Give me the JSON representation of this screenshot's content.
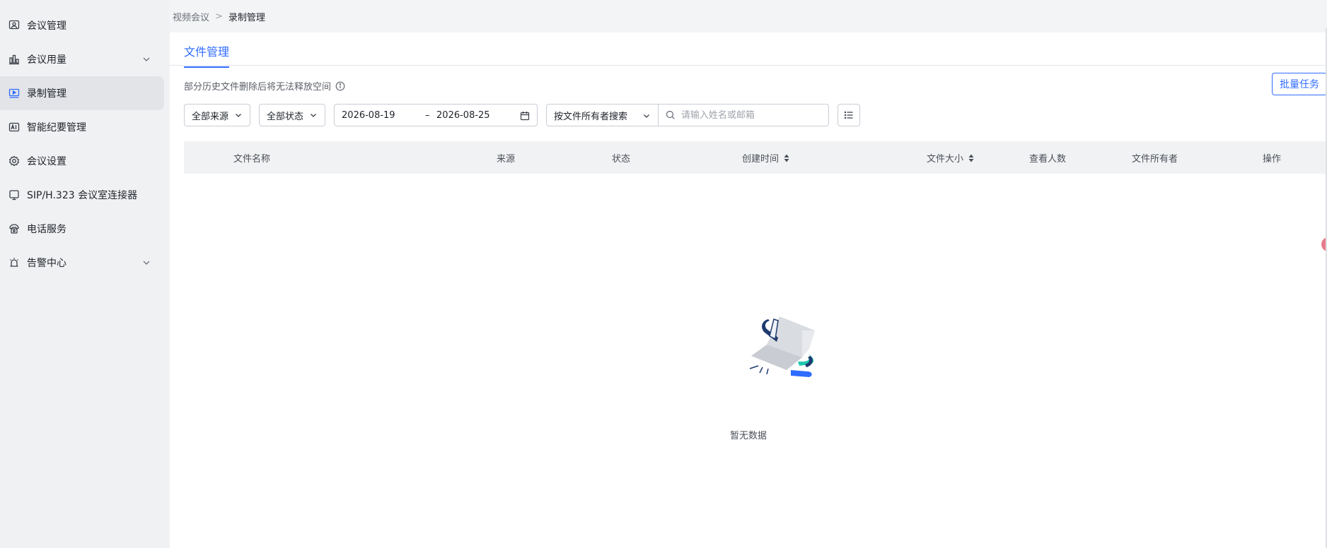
{
  "sidebar": {
    "items": [
      {
        "label": "会议管理",
        "icon": "meeting-manage-icon"
      },
      {
        "label": "会议用量",
        "icon": "bar-chart-icon",
        "expandable": true
      },
      {
        "label": "录制管理",
        "icon": "record-icon",
        "active": true
      },
      {
        "label": "智能纪要管理",
        "icon": "ai-icon"
      },
      {
        "label": "会议设置",
        "icon": "gear-icon"
      },
      {
        "label": "SIP/H.323 会议室连接器",
        "icon": "monitor-icon"
      },
      {
        "label": "电话服务",
        "icon": "phone-icon"
      },
      {
        "label": "告警中心",
        "icon": "alarm-icon",
        "expandable": true
      }
    ]
  },
  "breadcrumb": {
    "parent": "视频会议",
    "sep": ">",
    "current": "录制管理"
  },
  "tabs": [
    {
      "label": "文件管理",
      "active": true
    }
  ],
  "notice": "部分历史文件删除后将无法释放空间",
  "batch_button": "批量任务",
  "filters": {
    "source": "全部来源",
    "status": "全部状态",
    "date_start": "2026-08-19",
    "date_sep": "–",
    "date_end": "2026-08-25",
    "search_type": "按文件所有者搜索",
    "search_placeholder": "请输入姓名或邮箱"
  },
  "table": {
    "columns": [
      "文件名称",
      "来源",
      "状态",
      "创建时间",
      "文件大小",
      "查看人数",
      "文件所有者",
      "操作"
    ]
  },
  "empty_text": "暂无数据",
  "colors": {
    "accent": "#2f6bff",
    "sidebar_bg": "#f0f1f3",
    "active_bg": "#e2e4e8"
  }
}
